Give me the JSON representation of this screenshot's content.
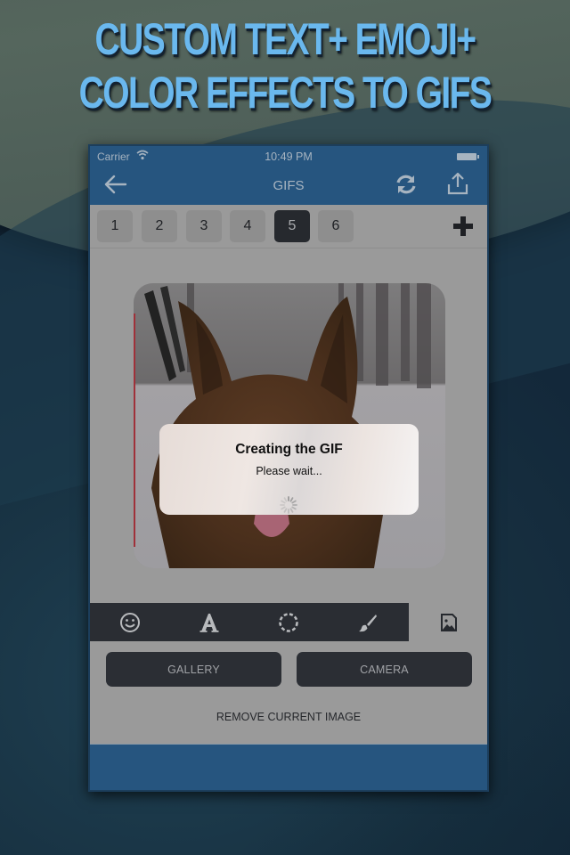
{
  "promo": {
    "line1": "CUSTOM TEXT+ EMOJI+",
    "line2": "COLOR EFFECTS TO GIFS"
  },
  "status_bar": {
    "carrier": "Carrier",
    "time": "10:49 PM",
    "wifi_icon": "wifi-icon",
    "battery_icon": "battery-icon"
  },
  "navbar": {
    "title": "GIFS",
    "back_icon": "arrow-left-icon",
    "refresh_icon": "refresh-icon",
    "share_icon": "share-upload-icon"
  },
  "frame_tabs": {
    "items": [
      {
        "label": "1",
        "active": false
      },
      {
        "label": "2",
        "active": false
      },
      {
        "label": "3",
        "active": false
      },
      {
        "label": "4",
        "active": false
      },
      {
        "label": "5",
        "active": true
      },
      {
        "label": "6",
        "active": false
      }
    ],
    "add_icon": "plus-icon"
  },
  "preview": {
    "subject": "German shepherd dog in snowy forest"
  },
  "alert": {
    "title": "Creating the GIF",
    "message": "Please wait...",
    "spinner_icon": "activity-spinner-icon"
  },
  "toolbar": {
    "tools": [
      {
        "name": "emoji",
        "icon": "smiley-icon",
        "active": false
      },
      {
        "name": "text",
        "icon": "text-a-icon",
        "active": false
      },
      {
        "name": "shape",
        "icon": "dashed-circle-icon",
        "active": false
      },
      {
        "name": "brush",
        "icon": "brush-icon",
        "active": false
      },
      {
        "name": "image",
        "icon": "image-icon",
        "active": true
      }
    ]
  },
  "actions": {
    "gallery": "GALLERY",
    "camera": "CAMERA",
    "remove": "REMOVE CURRENT IMAGE"
  },
  "colors": {
    "navbar": "#26557f",
    "headline": "#6ab8ee",
    "dark_button": "#2b2e34",
    "overlay_gray": "#9a9a9a"
  }
}
